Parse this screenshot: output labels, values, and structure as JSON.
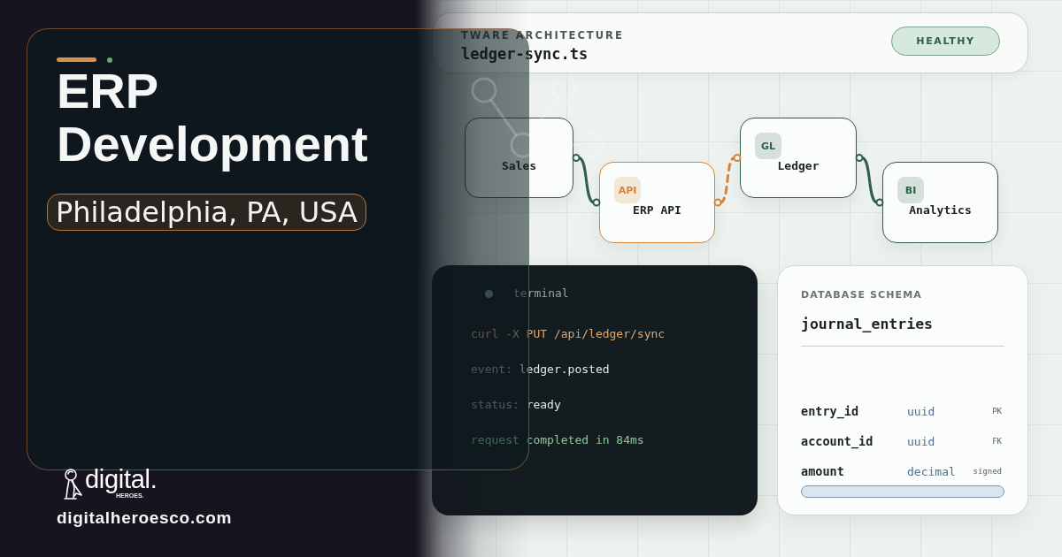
{
  "title_card": {
    "title": "ERP Development",
    "location": "Philadelphia, PA, USA"
  },
  "logo": {
    "name": "digital.",
    "tagline": "HEROES."
  },
  "website": "digitalheroesco.com",
  "architecture": {
    "label": "TWARE ARCHITECTURE",
    "file": "ledger-sync.ts",
    "status": "HEALTHY"
  },
  "diagram": {
    "nodes": [
      {
        "label": "Sales",
        "color": "#2f5e4a"
      },
      {
        "label": "ERP API",
        "badge": "API",
        "color": "#d4843a"
      },
      {
        "label": "Ledger",
        "badge": "GL",
        "color": "#2f5e4a"
      },
      {
        "label": "Analytics",
        "badge": "BI",
        "color": "#2f5e4a"
      }
    ],
    "edges": [
      {
        "kind": "solid",
        "color": "#2f5e4a"
      },
      {
        "kind": "dashed",
        "color": "#d4843a"
      },
      {
        "kind": "solid",
        "color": "#2f5e4a"
      }
    ]
  },
  "terminal": {
    "title": "terminal",
    "lines": [
      {
        "kind": "command",
        "text": "curl -X PUT /api/ledger/sync"
      },
      {
        "kind": "field",
        "key": "event:",
        "value": "ledger.posted"
      },
      {
        "kind": "field",
        "key": "status:",
        "value": "ready"
      },
      {
        "kind": "result",
        "text": "request completed in 84ms"
      }
    ]
  },
  "schema": {
    "label": "DATABASE SCHEMA",
    "table": "journal_entries",
    "columns": [
      {
        "name": "entry_id",
        "type": "uuid",
        "tag": "PK"
      },
      {
        "name": "account_id",
        "type": "uuid",
        "tag": "FK"
      },
      {
        "name": "amount",
        "type": "decimal",
        "tag": "signed"
      }
    ]
  }
}
